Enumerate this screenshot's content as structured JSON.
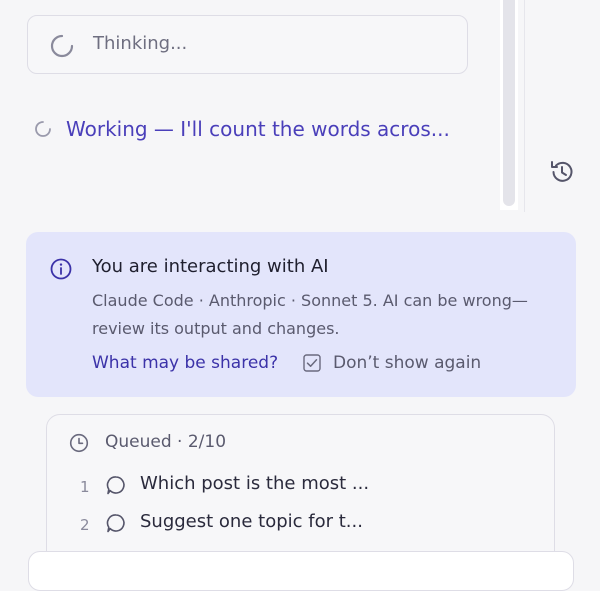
{
  "thinking": {
    "label": "Thinking..."
  },
  "working": {
    "label": "Working — I'll count the words acros..."
  },
  "history_button": {
    "icon": "history-icon"
  },
  "notice": {
    "title": "You are interacting with AI",
    "body": "Claude Code · Anthropic · Sonnet 5. AI can be wrong—review its output and changes.",
    "link": "What may be shared?",
    "dont_show_label": "Don’t show again",
    "dont_show_checked": true
  },
  "queue": {
    "title": "Queued · 2/10",
    "items": [
      {
        "number": "1",
        "text": "Which post is the most ..."
      },
      {
        "number": "2",
        "text": "Suggest one topic for t..."
      }
    ]
  },
  "colors": {
    "accent": "#4a3fba",
    "notice_bg": "#e3e5fb",
    "page_bg": "#f6f6f8"
  }
}
